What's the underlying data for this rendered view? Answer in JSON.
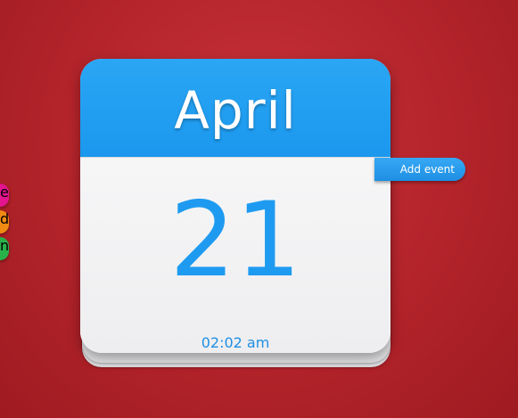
{
  "calendar": {
    "month": "April",
    "day": "21",
    "time": "02:02 am"
  },
  "tabs": {
    "add_event_label": "Add event",
    "pink_label": "e",
    "orange_label": "d",
    "green_label": "n"
  },
  "colors": {
    "background": "#b3232a",
    "header_blue": "#1b98ee",
    "day_blue": "#1e9bf0",
    "tab_pink": "#e3148e",
    "tab_orange": "#f08a12",
    "tab_green": "#29b24a"
  }
}
